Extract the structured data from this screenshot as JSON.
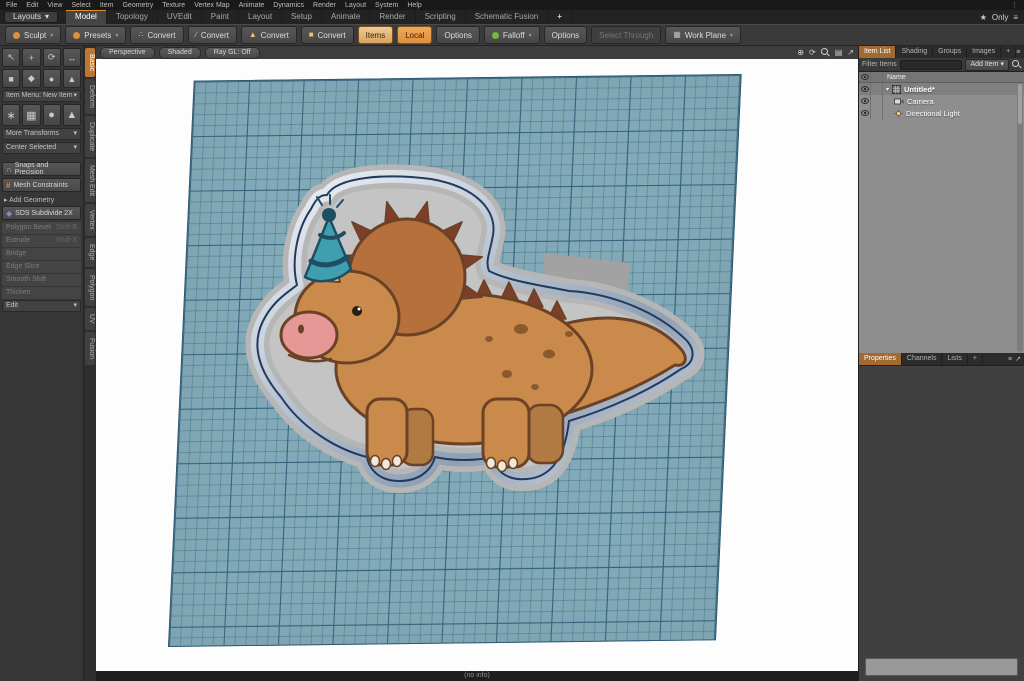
{
  "menubar": {
    "items": [
      "File",
      "Edit",
      "View",
      "Select",
      "Item",
      "Geometry",
      "Texture",
      "Vertex Map",
      "Animate",
      "Dynamics",
      "Render",
      "Layout",
      "System",
      "Help"
    ]
  },
  "layout_bar": {
    "layouts": "Layouts",
    "tabs": [
      "Model",
      "Topology",
      "UVEdit",
      "Paint",
      "Layout",
      "Setup",
      "Animate",
      "Render",
      "Scripting",
      "Schematic Fusion"
    ],
    "active_tab": "Model",
    "add_tab": "+",
    "only": "Only"
  },
  "toolbar": {
    "sculpt": "Sculpt",
    "presets": "Presets",
    "convert1": "Convert",
    "convert2": "Convert",
    "convert3": "Convert",
    "convert4": "Convert",
    "items": "Items",
    "local": "Local",
    "options_a": "Options",
    "falloff": "Falloff",
    "options_b": "Options",
    "select_through": "Select Through",
    "work_plane": "Work Plane"
  },
  "toolbox": {
    "item_menu": "Item Menu: New Item",
    "more_transforms": "More Transforms",
    "center_selected": "Center Selected",
    "snaps": "Snaps and Precision",
    "mesh_constraints": "Mesh Constraints",
    "add_geometry": "Add Geometry",
    "sds_subdivide": "SDS Subdivide 2X",
    "tools": [
      {
        "label": "Polygon Bevel",
        "shortcut": "Shift-B"
      },
      {
        "label": "Extrude",
        "shortcut": "Shift-X"
      },
      {
        "label": "Bridge",
        "shortcut": ""
      },
      {
        "label": "Edge Slice",
        "shortcut": ""
      },
      {
        "label": "Smooth Shift",
        "shortcut": ""
      },
      {
        "label": "Thicken",
        "shortcut": ""
      }
    ],
    "edit": "Edit"
  },
  "vertical_tabs": [
    "Basic",
    "Deform",
    "Duplicate",
    "Mesh Edit",
    "Vertex",
    "Edge",
    "Polygon",
    "UV",
    "Fusion"
  ],
  "viewport": {
    "view": "Perspective",
    "shading": "Shaded",
    "raygl": "Ray GL: Off",
    "status": "(no info)"
  },
  "item_list": {
    "tabs": [
      "Item List",
      "Shading",
      "Groups",
      "Images"
    ],
    "add_tab": "+",
    "filter_label": "Filter Items",
    "add_item": "Add Item",
    "name_header": "Name",
    "rows": [
      {
        "name": "Untitled*"
      },
      {
        "name": "Camera"
      },
      {
        "name": "Directional Light"
      }
    ]
  },
  "lower_panel": {
    "tabs": [
      "Properties",
      "Channels",
      "Lists"
    ],
    "add_tab": "+"
  },
  "icons": {
    "caret_down": "▾",
    "caret_right": "▸",
    "star": "★",
    "dots": "⋮",
    "menu": "≡",
    "pan": "⊕",
    "orbit": "⟳",
    "stats": "▤",
    "maximize": "↗",
    "tb1": "↖",
    "tb2": "+",
    "tb3": "⟳",
    "tb4": "↔",
    "tb5": "■",
    "tb6": "◆",
    "tb7": "●",
    "tb8": "▲",
    "prim_axis": "∗",
    "prim_plane": "▦",
    "prim_ball": "●",
    "prim_cone": "▲",
    "convert1": "∴",
    "convert2": "∕",
    "convert3": "▲",
    "convert4": "■",
    "snaps": "∩",
    "constraints": "#",
    "sds": "◆",
    "expander": "▾"
  },
  "colors": {
    "accent_orange": "#d98a3a",
    "grid_teal": "#82a9b7",
    "grid_line_major": "#33627d",
    "falloff_green": "#76b93e"
  }
}
